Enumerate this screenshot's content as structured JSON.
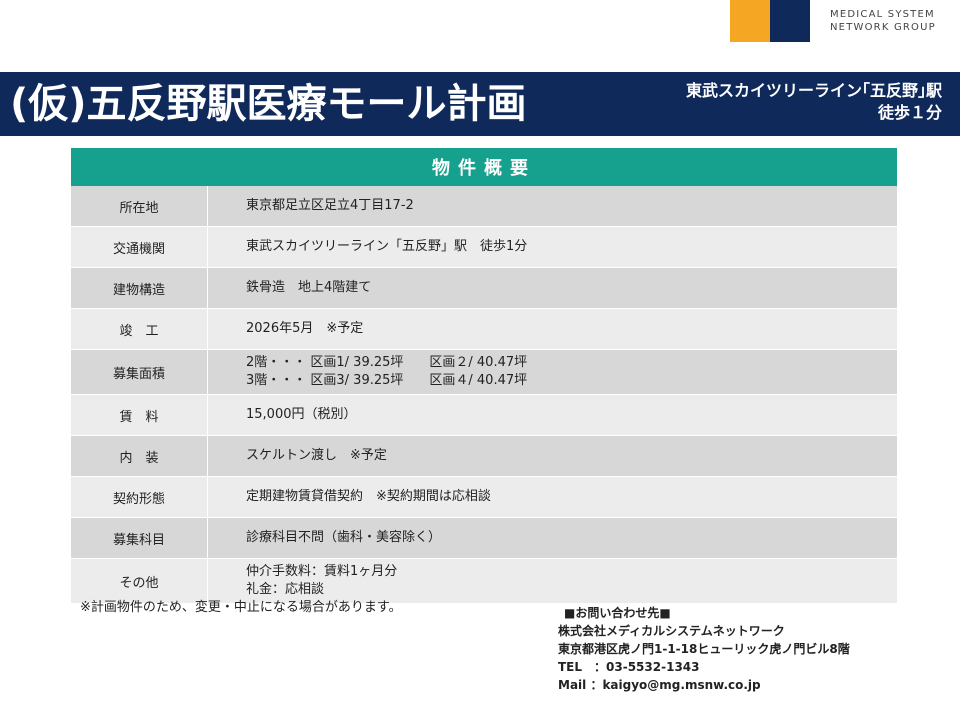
{
  "logo": {
    "line1": "MEDICAL SYSTEM",
    "line2": "NETWORK GROUP",
    "colors": {
      "orange": "#f5a623",
      "navy": "#0f2a5a"
    }
  },
  "banner": {
    "title": "(仮)五反野駅医療モール計画",
    "access_line1": "東武スカイツリーライン｢五反野｣駅",
    "access_line2": "徒歩１分"
  },
  "table": {
    "header": "物件概要",
    "rows": [
      {
        "label": "所在地",
        "values": [
          "東京都足立区足立4丁目17-2"
        ]
      },
      {
        "label": "交通機関",
        "values": [
          "東武スカイツリーライン「五反野」駅　徒歩1分"
        ]
      },
      {
        "label": "建物構造",
        "values": [
          "鉄骨造　地上4階建て"
        ]
      },
      {
        "label": "竣　工",
        "values": [
          "2026年5月　※予定"
        ]
      },
      {
        "label": "募集面積",
        "values": [
          "2階・・・ 区画1/ 39.25坪　　区画２/ 40.47坪",
          "3階・・・ 区画3/ 39.25坪　　区画４/ 40.47坪"
        ]
      },
      {
        "label": "賃　料",
        "values": [
          "15,000円（税別）"
        ]
      },
      {
        "label": "内　装",
        "values": [
          "スケルトン渡し　※予定"
        ]
      },
      {
        "label": "契約形態",
        "values": [
          "定期建物賃貸借契約　※契約期間は応相談"
        ]
      },
      {
        "label": "募集科目",
        "values": [
          "診療科目不問（歯科・美容除く）"
        ]
      },
      {
        "label": "その他",
        "values": [
          "仲介手数料：賃料1ヶ月分",
          "礼金：応相談"
        ]
      }
    ]
  },
  "note": "※計画物件のため、変更・中止になる場合があります。",
  "contact": {
    "heading": "■お問い合わせ先■",
    "company": "株式会社メディカルシステムネットワーク",
    "address": "東京都港区虎ノ門1-1-18ヒューリック虎ノ門ビル8階",
    "tel": "TEL　：03-5532-1343",
    "mail": "Mail ：kaigyo@mg.msnw.co.jp"
  }
}
